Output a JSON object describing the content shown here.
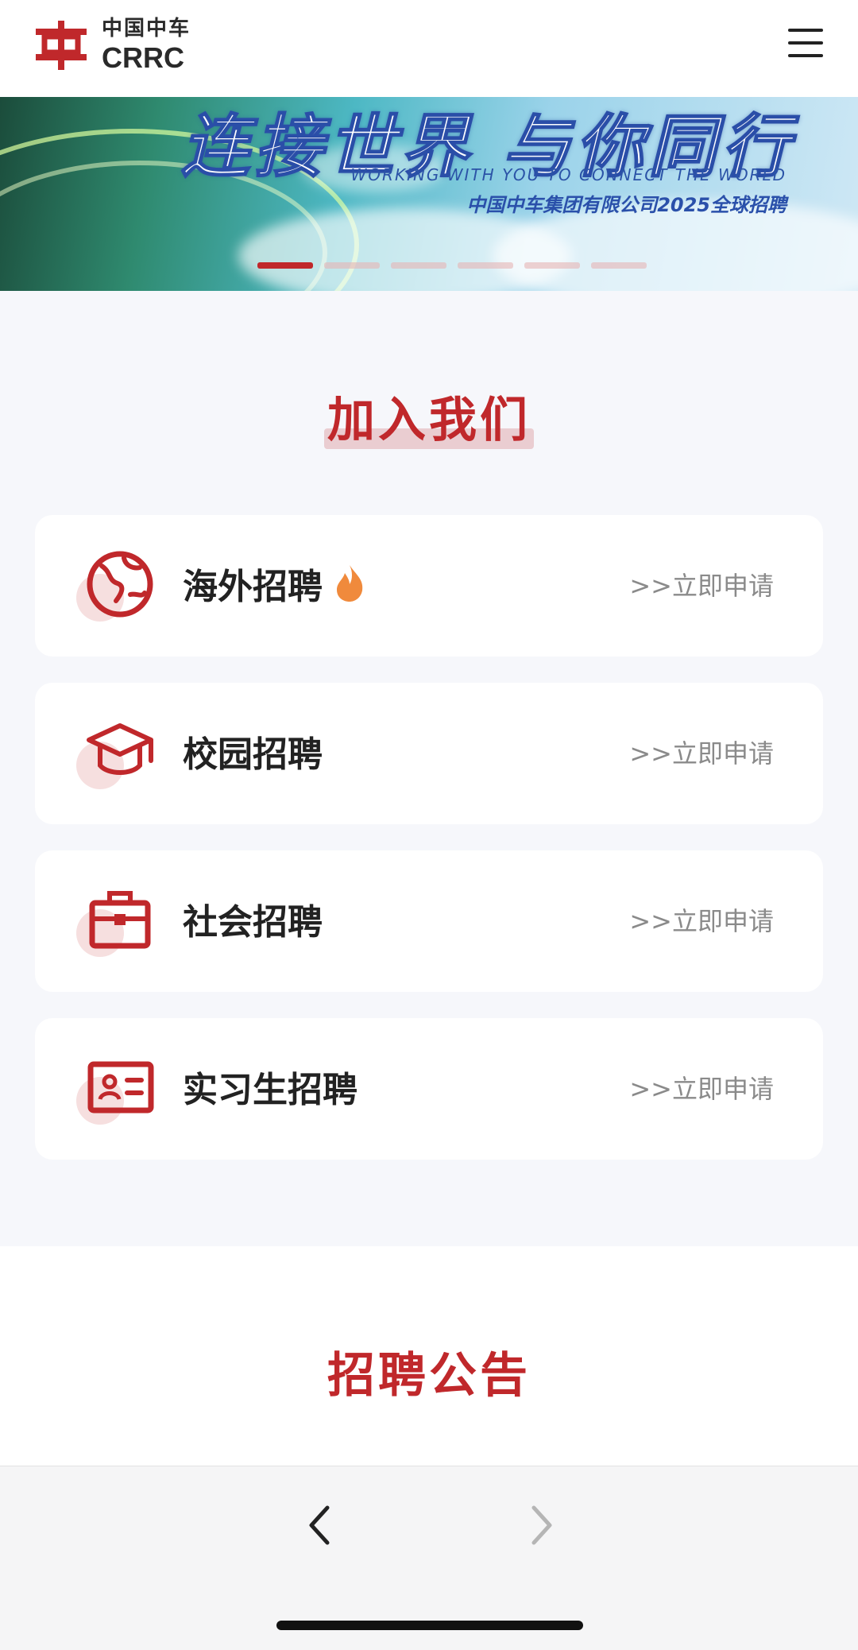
{
  "header": {
    "logo_cn": "中国中车",
    "logo_en": "CRRC",
    "menu_icon": "hamburger-menu-icon"
  },
  "banner": {
    "title": "连接世界 与你同行",
    "subtitle_en": "WORKING WITH YOU TO CONNECT THE WORLD",
    "subtitle_cn": "中国中车集团有限公司2025全球招聘",
    "slide_count": 6,
    "active_slide": 1
  },
  "join_section": {
    "title": "加入我们",
    "cards": [
      {
        "label": "海外招聘",
        "action": ">>立即申请",
        "icon": "globe-icon",
        "hot": true
      },
      {
        "label": "校园招聘",
        "action": ">>立即申请",
        "icon": "graduation-cap-icon",
        "hot": false
      },
      {
        "label": "社会招聘",
        "action": ">>立即申请",
        "icon": "briefcase-icon",
        "hot": false
      },
      {
        "label": "实习生招聘",
        "action": ">>立即申请",
        "icon": "id-card-icon",
        "hot": false
      }
    ]
  },
  "announcement_section": {
    "title": "招聘公告"
  },
  "browser_nav": {
    "back_icon": "chevron-left-icon",
    "forward_icon": "chevron-right-icon"
  },
  "colors": {
    "brand_red": "#c0282b",
    "page_bg": "#f6f7fb",
    "muted_text": "#8a8a8a"
  }
}
